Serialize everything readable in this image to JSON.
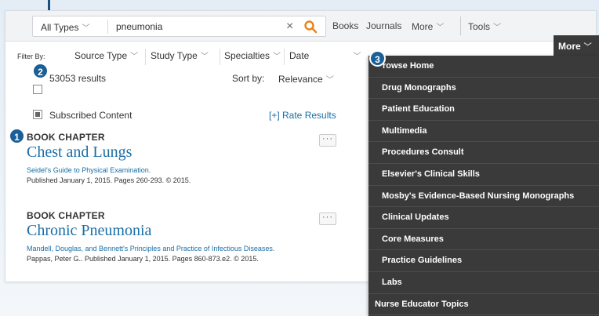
{
  "search": {
    "type_label": "All Types",
    "query": "pneumonia"
  },
  "nav": {
    "books": "Books",
    "journals": "Journals",
    "more": "More",
    "tools": "Tools"
  },
  "filters": {
    "label": "Filter By:",
    "items": [
      "Source Type",
      "Study Type",
      "Specialties",
      "Date"
    ]
  },
  "results": {
    "count_text": "53053 results",
    "sort_label": "Sort by:",
    "sort_value": "Relevance",
    "subscribed_label": "Subscribed Content",
    "rate_link": "[+] Rate Results",
    "items": [
      {
        "type": "BOOK CHAPTER",
        "title": "Chest and Lungs",
        "source": "Seidel's Guide to Physical Examination.",
        "meta": "Published January 1, 2015. Pages 260-293. © 2015."
      },
      {
        "type": "BOOK CHAPTER",
        "title": "Chronic Pneumonia",
        "source": "Mandell, Douglas, and Bennett's Principles and Practice of Infectious Diseases.",
        "meta": "Pappas, Peter G.. Published January 1, 2015. Pages 860-873.e2. © 2015."
      }
    ],
    "more_dots": "···"
  },
  "callouts": {
    "one": "1",
    "two": "2",
    "three": "3"
  },
  "more_menu": {
    "trigger": "More",
    "items": [
      "rowse Home",
      "Drug Monographs",
      "Patient Education",
      "Multimedia",
      "Procedures Consult",
      "Elsevier's Clinical Skills",
      "Mosby's Evidence-Based Nursing Monographs",
      "Clinical Updates",
      "Core Measures",
      "Practice Guidelines",
      "Labs",
      "Nurse Educator Topics"
    ]
  },
  "colors": {
    "link": "#1a6ea6",
    "badge": "#1b5f96",
    "search_accent": "#e8821e",
    "menu_bg": "#3a3a3a"
  },
  "icons": {
    "type_chevron": "chevron-down-icon",
    "clear": "close-icon",
    "search": "search-icon"
  }
}
